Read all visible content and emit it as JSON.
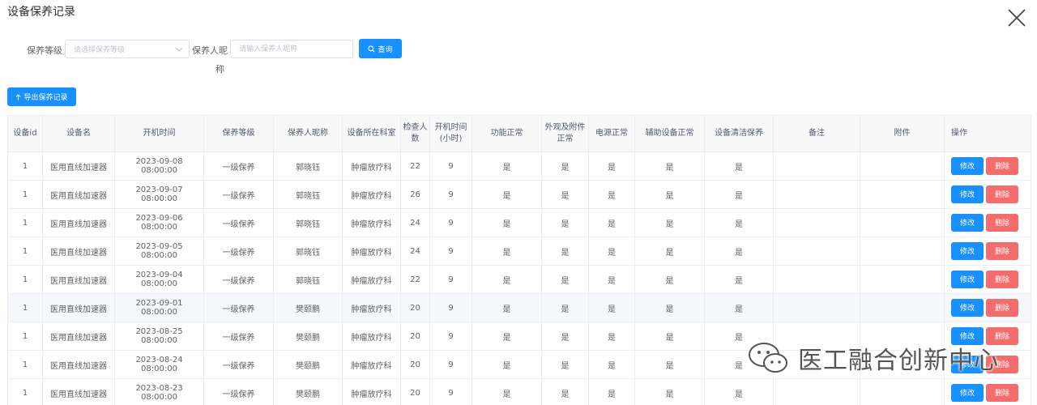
{
  "dialog": {
    "title": "设备保养记录"
  },
  "filters": {
    "level_label": "保养等级",
    "level_placeholder": "请选择保养等级",
    "person_label_line1": "保养人昵",
    "person_label_line2": "称",
    "person_placeholder": "请输入保养人昵称",
    "query_label": "查询"
  },
  "toolbar": {
    "export_label": "导出保养记录"
  },
  "table": {
    "headers": {
      "id": "设备id",
      "name": "设备名",
      "start_time": "开机时间",
      "level": "保养等级",
      "person": "保养人昵称",
      "dept": "设备所在科室",
      "count": "检查人数",
      "hours": "开机时间(小时)",
      "func": "功能正常",
      "appearance": "外观及附件正常",
      "power": "电源正常",
      "aux": "辅助设备正常",
      "clean": "设备清洁保养",
      "remark": "备注",
      "attach": "附件",
      "ops": "操作"
    },
    "edit_label": "修改",
    "delete_label": "删除",
    "rows": [
      {
        "id": "1",
        "name": "医用直线加速器",
        "start_time": "2023-09-08 08:00:00",
        "level": "一级保养",
        "person": "郭晓钰",
        "dept": "肿瘤放疗科",
        "count": "22",
        "hours": "9",
        "func": "是",
        "appearance": "是",
        "power": "是",
        "aux": "是",
        "clean": "是",
        "remark": "",
        "attach": ""
      },
      {
        "id": "1",
        "name": "医用直线加速器",
        "start_time": "2023-09-07 08:00:00",
        "level": "一级保养",
        "person": "郭晓钰",
        "dept": "肿瘤放疗科",
        "count": "26",
        "hours": "9",
        "func": "是",
        "appearance": "是",
        "power": "是",
        "aux": "是",
        "clean": "是",
        "remark": "",
        "attach": ""
      },
      {
        "id": "1",
        "name": "医用直线加速器",
        "start_time": "2023-09-06 08:00:00",
        "level": "一级保养",
        "person": "郭晓钰",
        "dept": "肿瘤放疗科",
        "count": "24",
        "hours": "9",
        "func": "是",
        "appearance": "是",
        "power": "是",
        "aux": "是",
        "clean": "是",
        "remark": "",
        "attach": ""
      },
      {
        "id": "1",
        "name": "医用直线加速器",
        "start_time": "2023-09-05 08:00:00",
        "level": "一级保养",
        "person": "郭晓钰",
        "dept": "肿瘤放疗科",
        "count": "24",
        "hours": "9",
        "func": "是",
        "appearance": "是",
        "power": "是",
        "aux": "是",
        "clean": "是",
        "remark": "",
        "attach": ""
      },
      {
        "id": "1",
        "name": "医用直线加速器",
        "start_time": "2023-09-04 08:00:00",
        "level": "一级保养",
        "person": "郭晓钰",
        "dept": "肿瘤放疗科",
        "count": "22",
        "hours": "9",
        "func": "是",
        "appearance": "是",
        "power": "是",
        "aux": "是",
        "clean": "是",
        "remark": "",
        "attach": ""
      },
      {
        "id": "1",
        "name": "医用直线加速器",
        "start_time": "2023-09-01 08:00:00",
        "level": "一级保养",
        "person": "樊颐鹏",
        "dept": "肿瘤放疗科",
        "count": "20",
        "hours": "9",
        "func": "是",
        "appearance": "是",
        "power": "是",
        "aux": "是",
        "clean": "是",
        "remark": "",
        "attach": ""
      },
      {
        "id": "1",
        "name": "医用直线加速器",
        "start_time": "2023-08-25 08:00:00",
        "level": "一级保养",
        "person": "樊颐鹏",
        "dept": "肿瘤放疗科",
        "count": "20",
        "hours": "9",
        "func": "是",
        "appearance": "是",
        "power": "是",
        "aux": "是",
        "clean": "是",
        "remark": "",
        "attach": ""
      },
      {
        "id": "1",
        "name": "医用直线加速器",
        "start_time": "2023-08-24 08:00:00",
        "level": "一级保养",
        "person": "樊颐鹏",
        "dept": "肿瘤放疗科",
        "count": "20",
        "hours": "9",
        "func": "是",
        "appearance": "是",
        "power": "是",
        "aux": "是",
        "clean": "是",
        "remark": "",
        "attach": ""
      },
      {
        "id": "1",
        "name": "医用直线加速器",
        "start_time": "2023-08-23 08:00:00",
        "level": "一级保养",
        "person": "樊颐鹏",
        "dept": "肿瘤放疗科",
        "count": "20",
        "hours": "9",
        "func": "是",
        "appearance": "是",
        "power": "是",
        "aux": "是",
        "clean": "是",
        "remark": "",
        "attach": ""
      }
    ]
  },
  "watermark": {
    "text": "医工融合创新中心"
  }
}
